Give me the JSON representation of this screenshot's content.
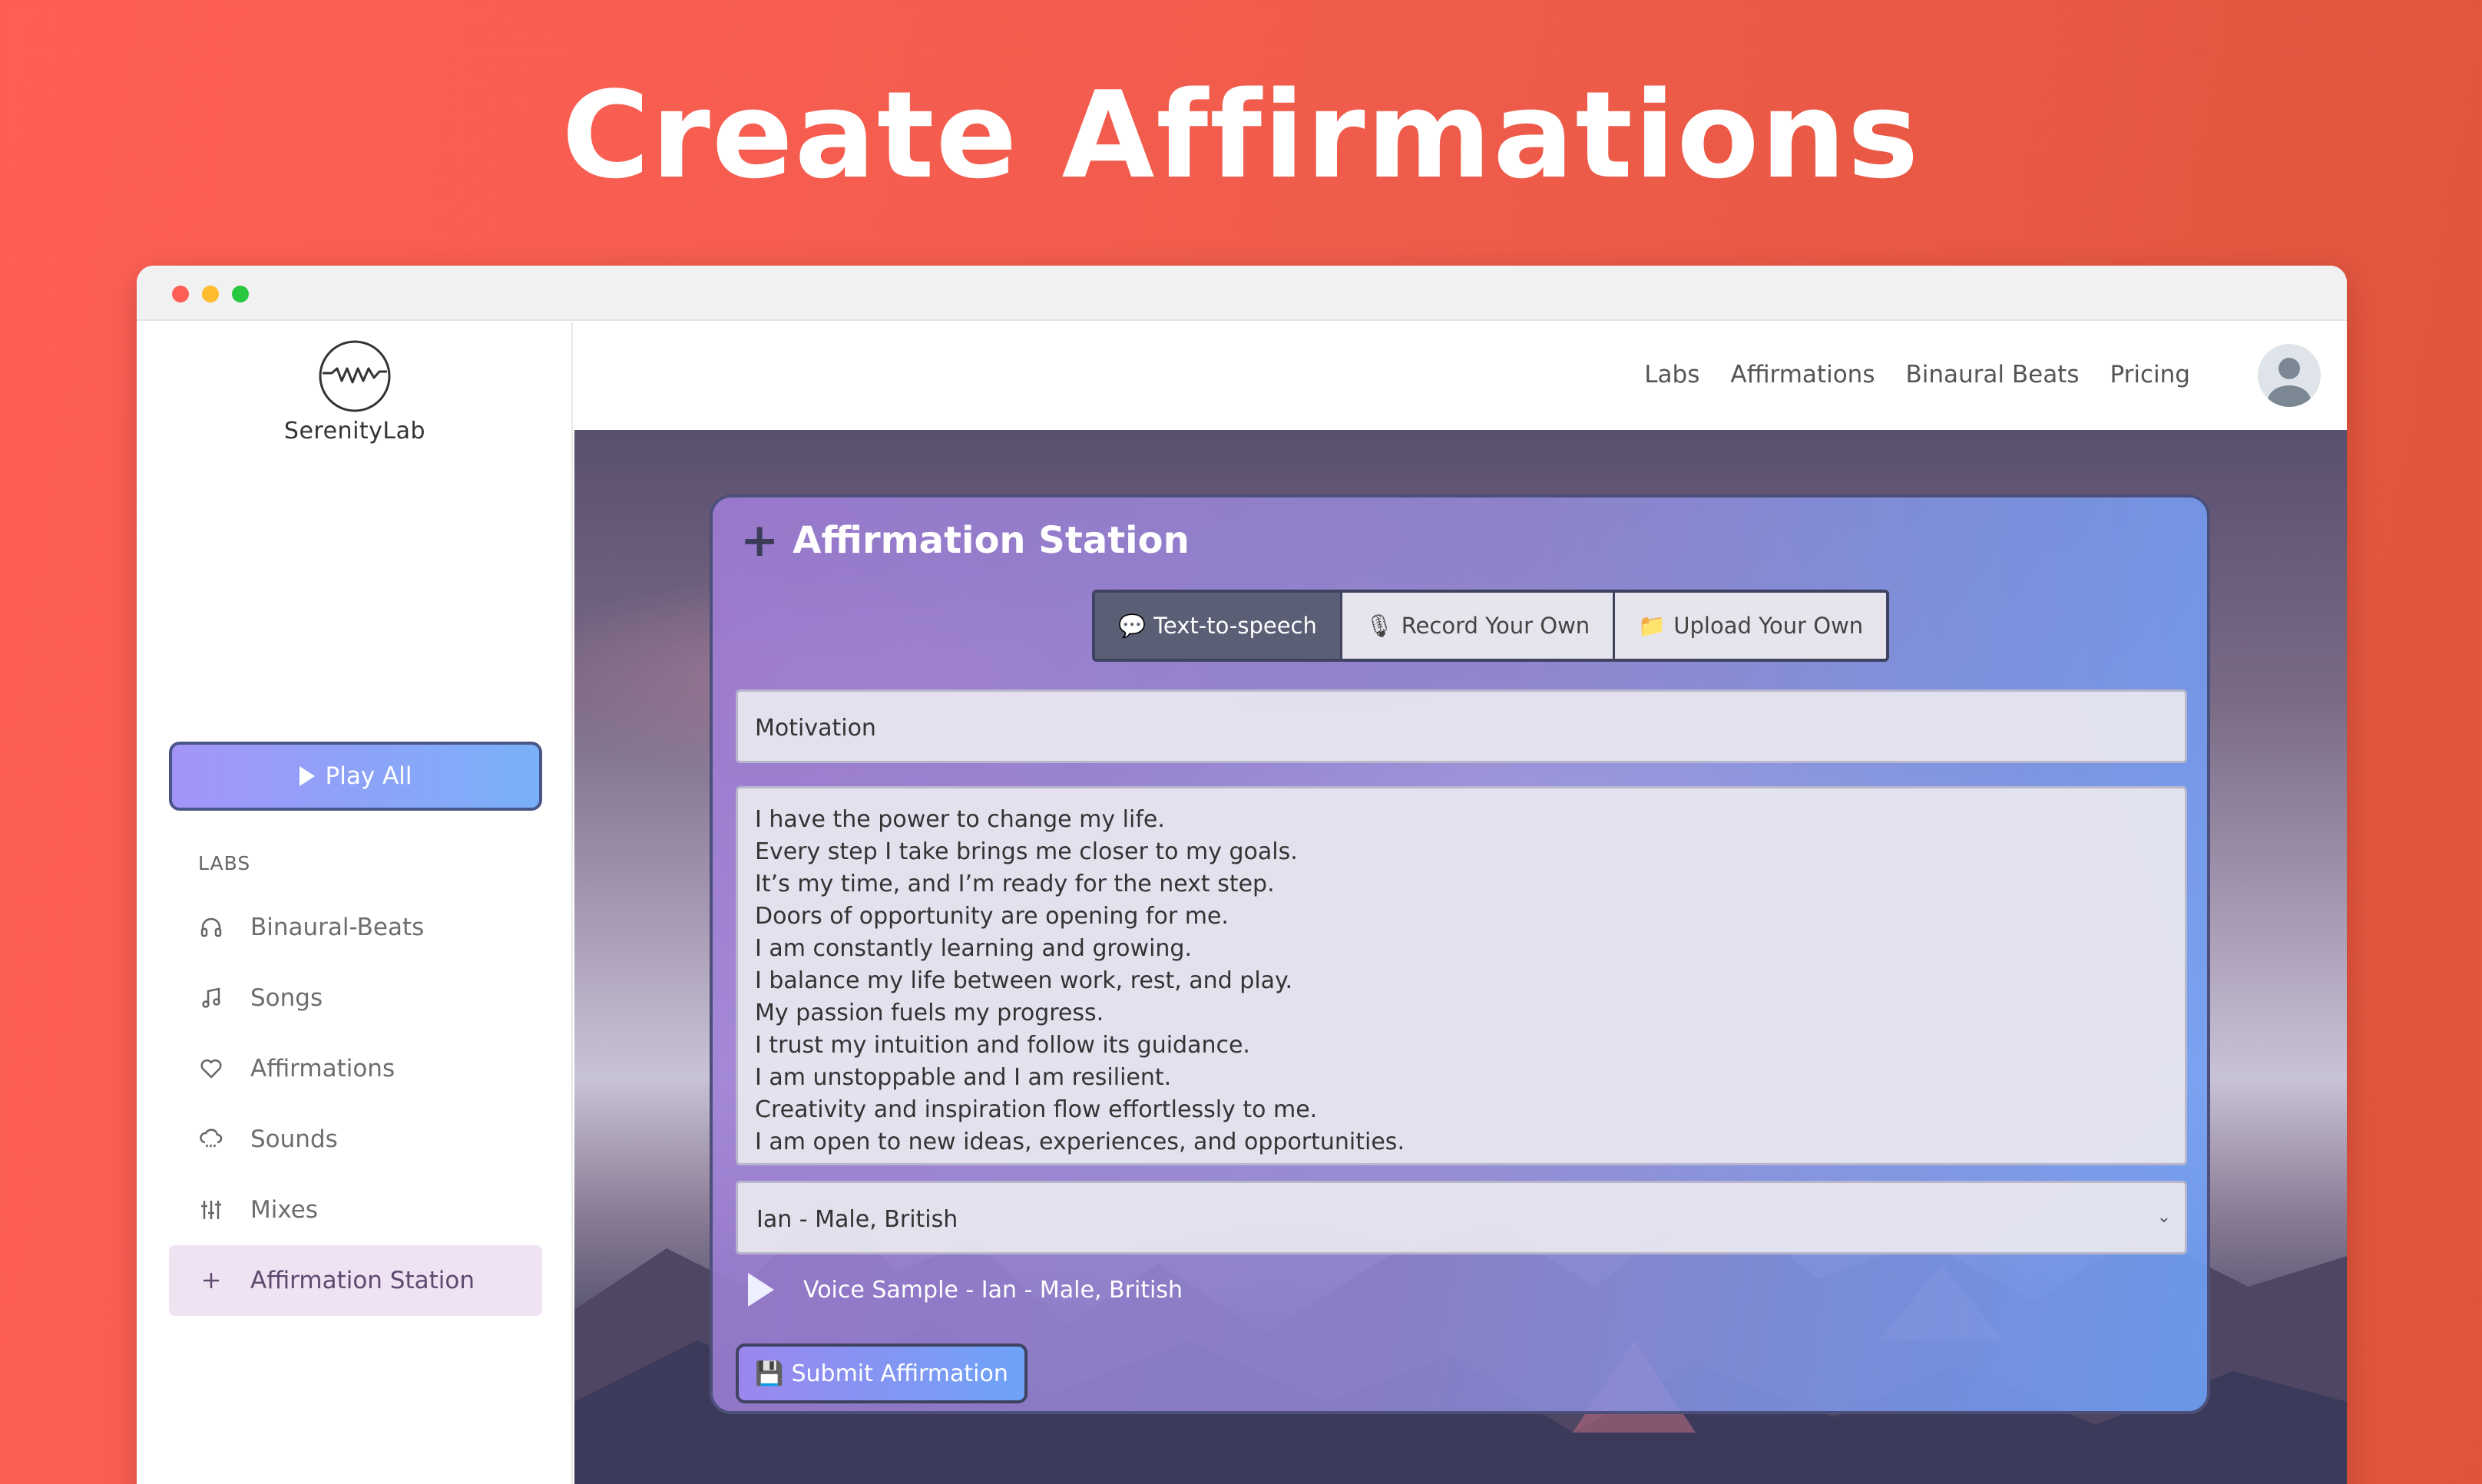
{
  "hero": {
    "title": "Create Affirmations"
  },
  "logo": {
    "text": "SerenityLab"
  },
  "sidebar": {
    "play_all": "Play All",
    "section_heading": "LABS",
    "items": [
      {
        "label": "Binaural-Beats",
        "icon": "headphones-icon"
      },
      {
        "label": "Songs",
        "icon": "music-note-icon"
      },
      {
        "label": "Affirmations",
        "icon": "heart-icon"
      },
      {
        "label": "Sounds",
        "icon": "rain-cloud-icon"
      },
      {
        "label": "Mixes",
        "icon": "sliders-icon"
      },
      {
        "label": "Affirmation Station",
        "icon": "plus-icon",
        "active": true
      }
    ]
  },
  "topnav": {
    "links": [
      "Labs",
      "Affirmations",
      "Binaural Beats",
      "Pricing"
    ]
  },
  "card": {
    "title": "Affirmation Station",
    "tabs": [
      {
        "label": "Text-to-speech",
        "icon": "speech-bubble-icon",
        "active": true
      },
      {
        "label": "Record Your Own",
        "icon": "microphone-icon"
      },
      {
        "label": "Upload Your Own",
        "icon": "folder-icon"
      }
    ],
    "name_value": "Motivation",
    "affirmations_text": "I have the power to change my life.\nEvery step I take brings me closer to my goals.\nIt’s my time, and I’m ready for the next step.\nDoors of opportunity are opening for me.\nI am constantly learning and growing.\nI balance my life between work, rest, and play.\nMy passion fuels my progress.\nI trust my intuition and follow its guidance.\nI am unstoppable and I am resilient.\nCreativity and inspiration flow effortlessly to me.\nI am open to new ideas, experiences, and opportunities.",
    "voice_selected": "Ian - Male, British",
    "voice_sample": "Voice Sample - Ian - Male, British",
    "submit_label": "Submit Affirmation"
  },
  "colors": {
    "background": "#fe5f55",
    "active_nav": "#efe2f3",
    "accent_gradient_start": "#a395f8",
    "accent_gradient_end": "#79b0f8"
  }
}
